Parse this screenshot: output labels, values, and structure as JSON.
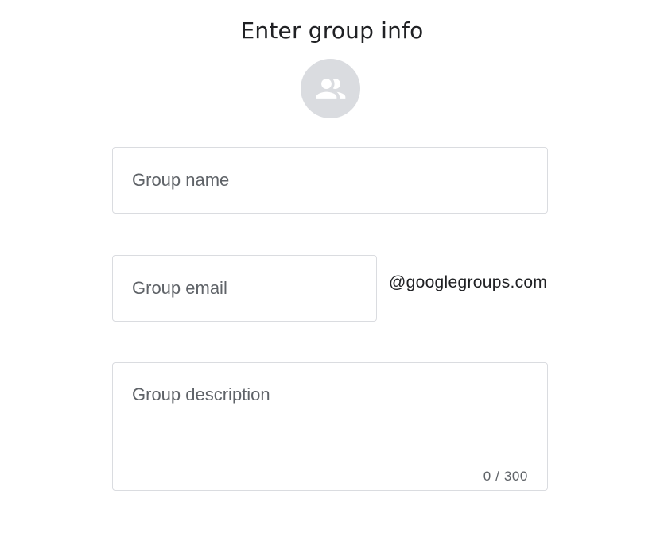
{
  "form": {
    "title": "Enter group info",
    "avatar_icon": "group-icon",
    "group_name": {
      "placeholder": "Group name",
      "value": ""
    },
    "group_email": {
      "placeholder": "Group email",
      "value": "",
      "domain_suffix": "@googlegroups.com"
    },
    "group_description": {
      "placeholder": "Group description",
      "value": "",
      "char_count": "0 / 300"
    }
  },
  "colors": {
    "text": "#202124",
    "placeholder": "#5f6368",
    "border": "#dadce0",
    "avatar_bg": "#dadce0"
  }
}
